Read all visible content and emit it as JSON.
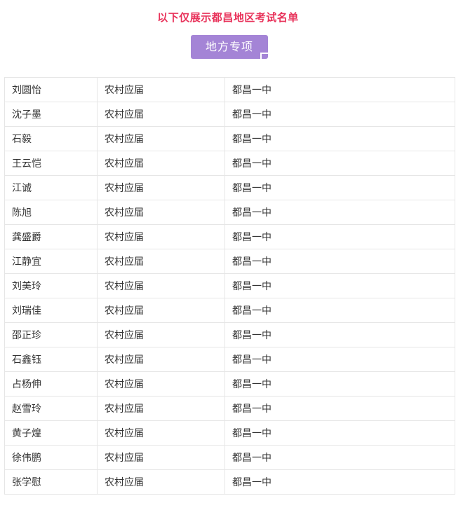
{
  "header": {
    "notice": "以下仅展示都昌地区考试名单",
    "badge_label": "地方专项"
  },
  "roster": {
    "rows": [
      {
        "name": "刘圆怡",
        "category": "农村应届",
        "school": "都昌一中"
      },
      {
        "name": "沈子墨",
        "category": "农村应届",
        "school": "都昌一中"
      },
      {
        "name": "石毅",
        "category": "农村应届",
        "school": "都昌一中"
      },
      {
        "name": "王云恺",
        "category": "农村应届",
        "school": "都昌一中"
      },
      {
        "name": "江诚",
        "category": "农村应届",
        "school": "都昌一中"
      },
      {
        "name": "陈旭",
        "category": "农村应届",
        "school": "都昌一中"
      },
      {
        "name": "龚盛爵",
        "category": "农村应届",
        "school": "都昌一中"
      },
      {
        "name": "江静宜",
        "category": "农村应届",
        "school": "都昌一中"
      },
      {
        "name": "刘美玲",
        "category": "农村应届",
        "school": "都昌一中"
      },
      {
        "name": "刘瑞佳",
        "category": "农村应届",
        "school": "都昌一中"
      },
      {
        "name": "邵正珍",
        "category": "农村应届",
        "school": "都昌一中"
      },
      {
        "name": "石鑫钰",
        "category": "农村应届",
        "school": "都昌一中"
      },
      {
        "name": "占杨伸",
        "category": "农村应届",
        "school": "都昌一中"
      },
      {
        "name": "赵雪玲",
        "category": "农村应届",
        "school": "都昌一中"
      },
      {
        "name": "黄子煌",
        "category": "农村应届",
        "school": "都昌一中"
      },
      {
        "name": "徐伟鹏",
        "category": "农村应届",
        "school": "都昌一中"
      },
      {
        "name": "张学慰",
        "category": "农村应届",
        "school": "都昌一中"
      }
    ]
  },
  "colors": {
    "notice_text": "#e8325a",
    "badge_bg": "#a484d6",
    "table_border": "#e6e6e6"
  }
}
